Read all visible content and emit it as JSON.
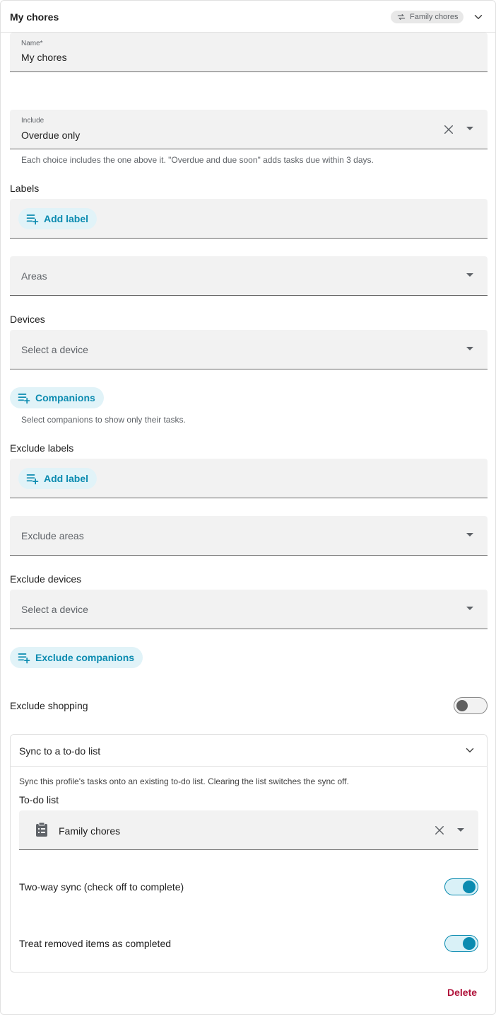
{
  "header": {
    "title": "My chores",
    "badge": "Family chores"
  },
  "name_field": {
    "label": "Name*",
    "value": "My chores"
  },
  "include_field": {
    "label": "Include",
    "value": "Overdue only",
    "helper": "Each choice includes the one above it. \"Overdue and due soon\" adds tasks due within 3 days."
  },
  "labels": {
    "heading": "Labels",
    "add_label": "Add label"
  },
  "areas": {
    "placeholder": "Areas"
  },
  "devices": {
    "heading": "Devices",
    "placeholder": "Select a device"
  },
  "companions": {
    "button": "Companions",
    "helper": "Select companions to show only their tasks."
  },
  "exclude_labels": {
    "heading": "Exclude labels",
    "add_label": "Add label"
  },
  "exclude_areas": {
    "placeholder": "Exclude areas"
  },
  "exclude_devices": {
    "heading": "Exclude devices",
    "placeholder": "Select a device"
  },
  "exclude_companions": {
    "button": "Exclude companions"
  },
  "exclude_shopping": {
    "label": "Exclude shopping",
    "enabled": false
  },
  "sync": {
    "title": "Sync to a to-do list",
    "description": "Sync this profile's tasks onto an existing to-do list. Clearing the list switches the sync off.",
    "todo_label": "To-do list",
    "todo_value": "Family chores",
    "two_way_label": "Two-way sync (check off to complete)",
    "two_way_enabled": true,
    "removed_label": "Treat removed items as completed",
    "removed_enabled": true
  },
  "footer": {
    "delete": "Delete"
  },
  "colors": {
    "accent": "#0b8bb0",
    "chip_bg": "#e1f3f8",
    "delete": "#b0123a"
  }
}
